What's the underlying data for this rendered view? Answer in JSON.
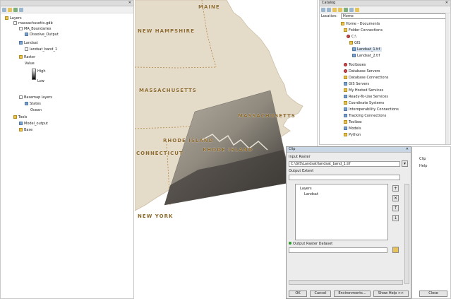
{
  "toc": {
    "rows": [
      {
        "label": "Layers",
        "icon": "layers"
      },
      {
        "label": "massachusetts.gdb",
        "icon": "database"
      },
      {
        "label": "MA_Boundaries",
        "icon": "layer"
      },
      {
        "label": "Dissolve_Output",
        "icon": "layer"
      },
      {
        "label": "Landsat",
        "icon": "raster"
      },
      {
        "label": "landsat_band_1",
        "icon": "raster"
      },
      {
        "label": "Raster",
        "icon": "raster"
      },
      {
        "label": "Value",
        "icon": "legend"
      },
      {
        "label": "High",
        "icon": "legend"
      },
      {
        "label": "Low",
        "icon": "legend"
      },
      {
        "label": "Basemap layers",
        "icon": "layer"
      },
      {
        "label": "States",
        "icon": "layer"
      },
      {
        "label": "Ocean",
        "icon": "layer"
      },
      {
        "label": "Tools",
        "icon": "folder"
      },
      {
        "label": "Model_output",
        "icon": "folder"
      },
      {
        "label": "Base",
        "icon": "folder"
      }
    ]
  },
  "map": {
    "labels": {
      "maine": "MAINE",
      "new_hampshire": "NEW HAMPSHIRE",
      "massachusetts_w": "MASSACHUSETTS",
      "massachusetts_e": "MASSACHUSETTS",
      "rhode_island": "RHODE ISLAND",
      "connecticut": "CONNECTICUT",
      "rhode_island2": "RHODE ISLAND",
      "new_york": "NEW YORK"
    }
  },
  "catalog": {
    "title": "Catalog",
    "location_label": "Location:",
    "location_value": "Home",
    "items": [
      "Home - Documents",
      "Folder Connections",
      "C:\\",
      "GIS",
      "Landsat_1.tif",
      "Landsat_2.tif",
      "Toolboxes",
      "Database Servers",
      "Database Connections",
      "GIS Servers",
      "My Hosted Services",
      "Ready-To-Use Services",
      "Coordinate Systems",
      "Interoperability Connections",
      "Tracking Connections",
      "Toolbox",
      "Models",
      "Python"
    ]
  },
  "dialog": {
    "title": "Clip",
    "input_label": "Input Raster",
    "input_value": "C:\\GIS\\Landsat\\landsat_band_1.tif",
    "extent_label": "Output Extent",
    "extent_value": "",
    "list_items": [
      "Layers",
      "Landsat"
    ],
    "output_label": "Output Raster Dataset",
    "output_value": "",
    "buttons": {
      "ok": "OK",
      "cancel": "Cancel",
      "environments": "Environments...",
      "show_help": "Show Help >>",
      "close": "Close"
    }
  },
  "right_panel": {
    "lines": [
      "Clip",
      "Help"
    ]
  },
  "colors": {
    "land": "#e5dbc9",
    "state_label": "#8c6a2d",
    "border_line": "#b48a4a"
  }
}
